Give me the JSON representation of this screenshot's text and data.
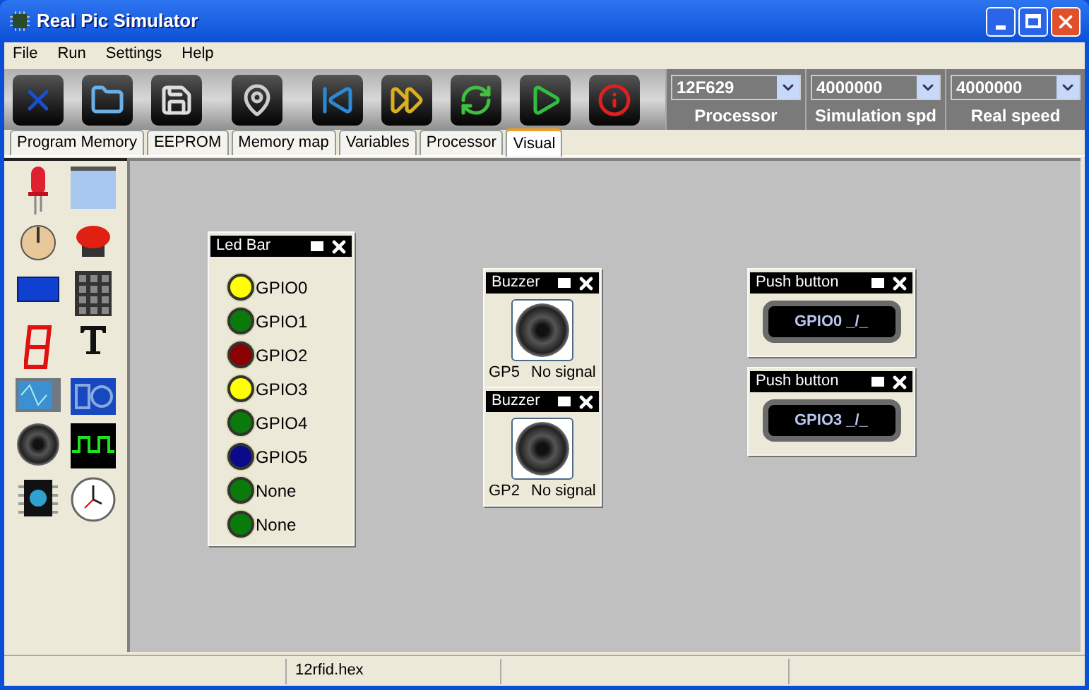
{
  "window": {
    "title": "Real Pic Simulator"
  },
  "menu": [
    "File",
    "Run",
    "Settings",
    "Help"
  ],
  "selectors": [
    {
      "value": "12F629",
      "label": "Processor"
    },
    {
      "value": "4000000",
      "label": "Simulation spd"
    },
    {
      "value": "4000000",
      "label": "Real speed"
    }
  ],
  "tabs": [
    {
      "label": "Program Memory",
      "selected": false
    },
    {
      "label": "EEPROM",
      "selected": false
    },
    {
      "label": "Memory map",
      "selected": false
    },
    {
      "label": "Variables",
      "selected": false
    },
    {
      "label": "Processor",
      "selected": false
    },
    {
      "label": "Visual",
      "selected": true
    }
  ],
  "widgets": [
    {
      "kind": "ledbar",
      "title": "Led Bar",
      "leds": [
        {
          "label": "GPIO0",
          "color": "#ffff00"
        },
        {
          "label": "GPIO1",
          "color": "#0a7a0a"
        },
        {
          "label": "GPIO2",
          "color": "#8b0000"
        },
        {
          "label": "GPIO3",
          "color": "#ffff00"
        },
        {
          "label": "GPIO4",
          "color": "#0a7a0a"
        },
        {
          "label": "GPIO5",
          "color": "#0a0a8b"
        },
        {
          "label": "None",
          "color": "#0a7a0a"
        },
        {
          "label": "None",
          "color": "#0a7a0a"
        }
      ]
    },
    {
      "kind": "buzzer",
      "title": "Buzzer",
      "pin": "GP5",
      "signal": "No signal"
    },
    {
      "kind": "buzzer",
      "title": "Buzzer",
      "pin": "GP2",
      "signal": "No signal"
    },
    {
      "kind": "pushbutton",
      "title": "Push button",
      "text": "GPIO0 _/_"
    },
    {
      "kind": "pushbutton",
      "title": "Push button",
      "text": "GPIO3 _/_"
    }
  ],
  "status_bar": [
    "12rfid.hex"
  ]
}
